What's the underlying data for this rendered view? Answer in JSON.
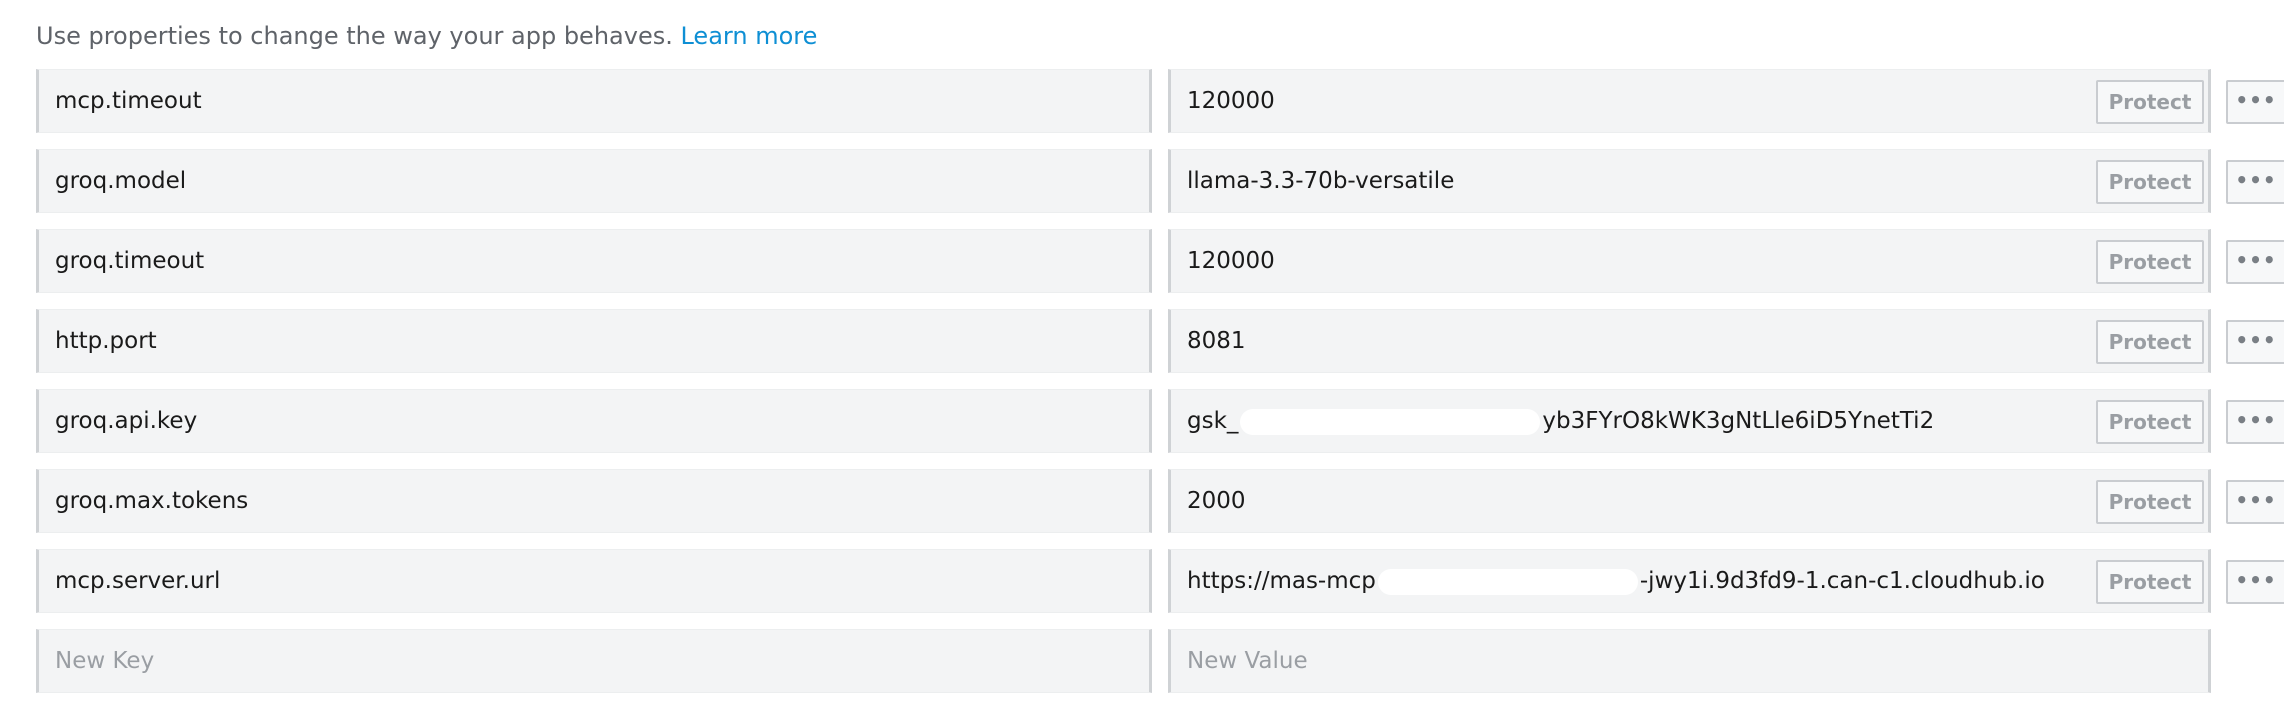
{
  "intro": {
    "text": "Use properties to change the way your app behaves.",
    "link": "Learn more"
  },
  "properties": [
    {
      "key": "mcp.timeout",
      "value": "120000"
    },
    {
      "key": "groq.model",
      "value": "llama-3.3-70b-versatile"
    },
    {
      "key": "groq.timeout",
      "value": "120000"
    },
    {
      "key": "http.port",
      "value": "8081"
    },
    {
      "key": "groq.api.key",
      "value_prefix": "gsk_",
      "value_suffix": "yb3FYrO8kWK3gNtLle6iD5YnetTi2"
    },
    {
      "key": "groq.max.tokens",
      "value": "2000"
    },
    {
      "key": "mcp.server.url",
      "value_prefix": "https://mas-mcp",
      "value_suffix": "-jwy1i.9d3fd9-1.can-c1.cloudhub.io"
    }
  ],
  "buttons": {
    "protect": "Protect",
    "more": "•••"
  },
  "new_row": {
    "key_placeholder": "New Key",
    "value_placeholder": "New Value"
  }
}
